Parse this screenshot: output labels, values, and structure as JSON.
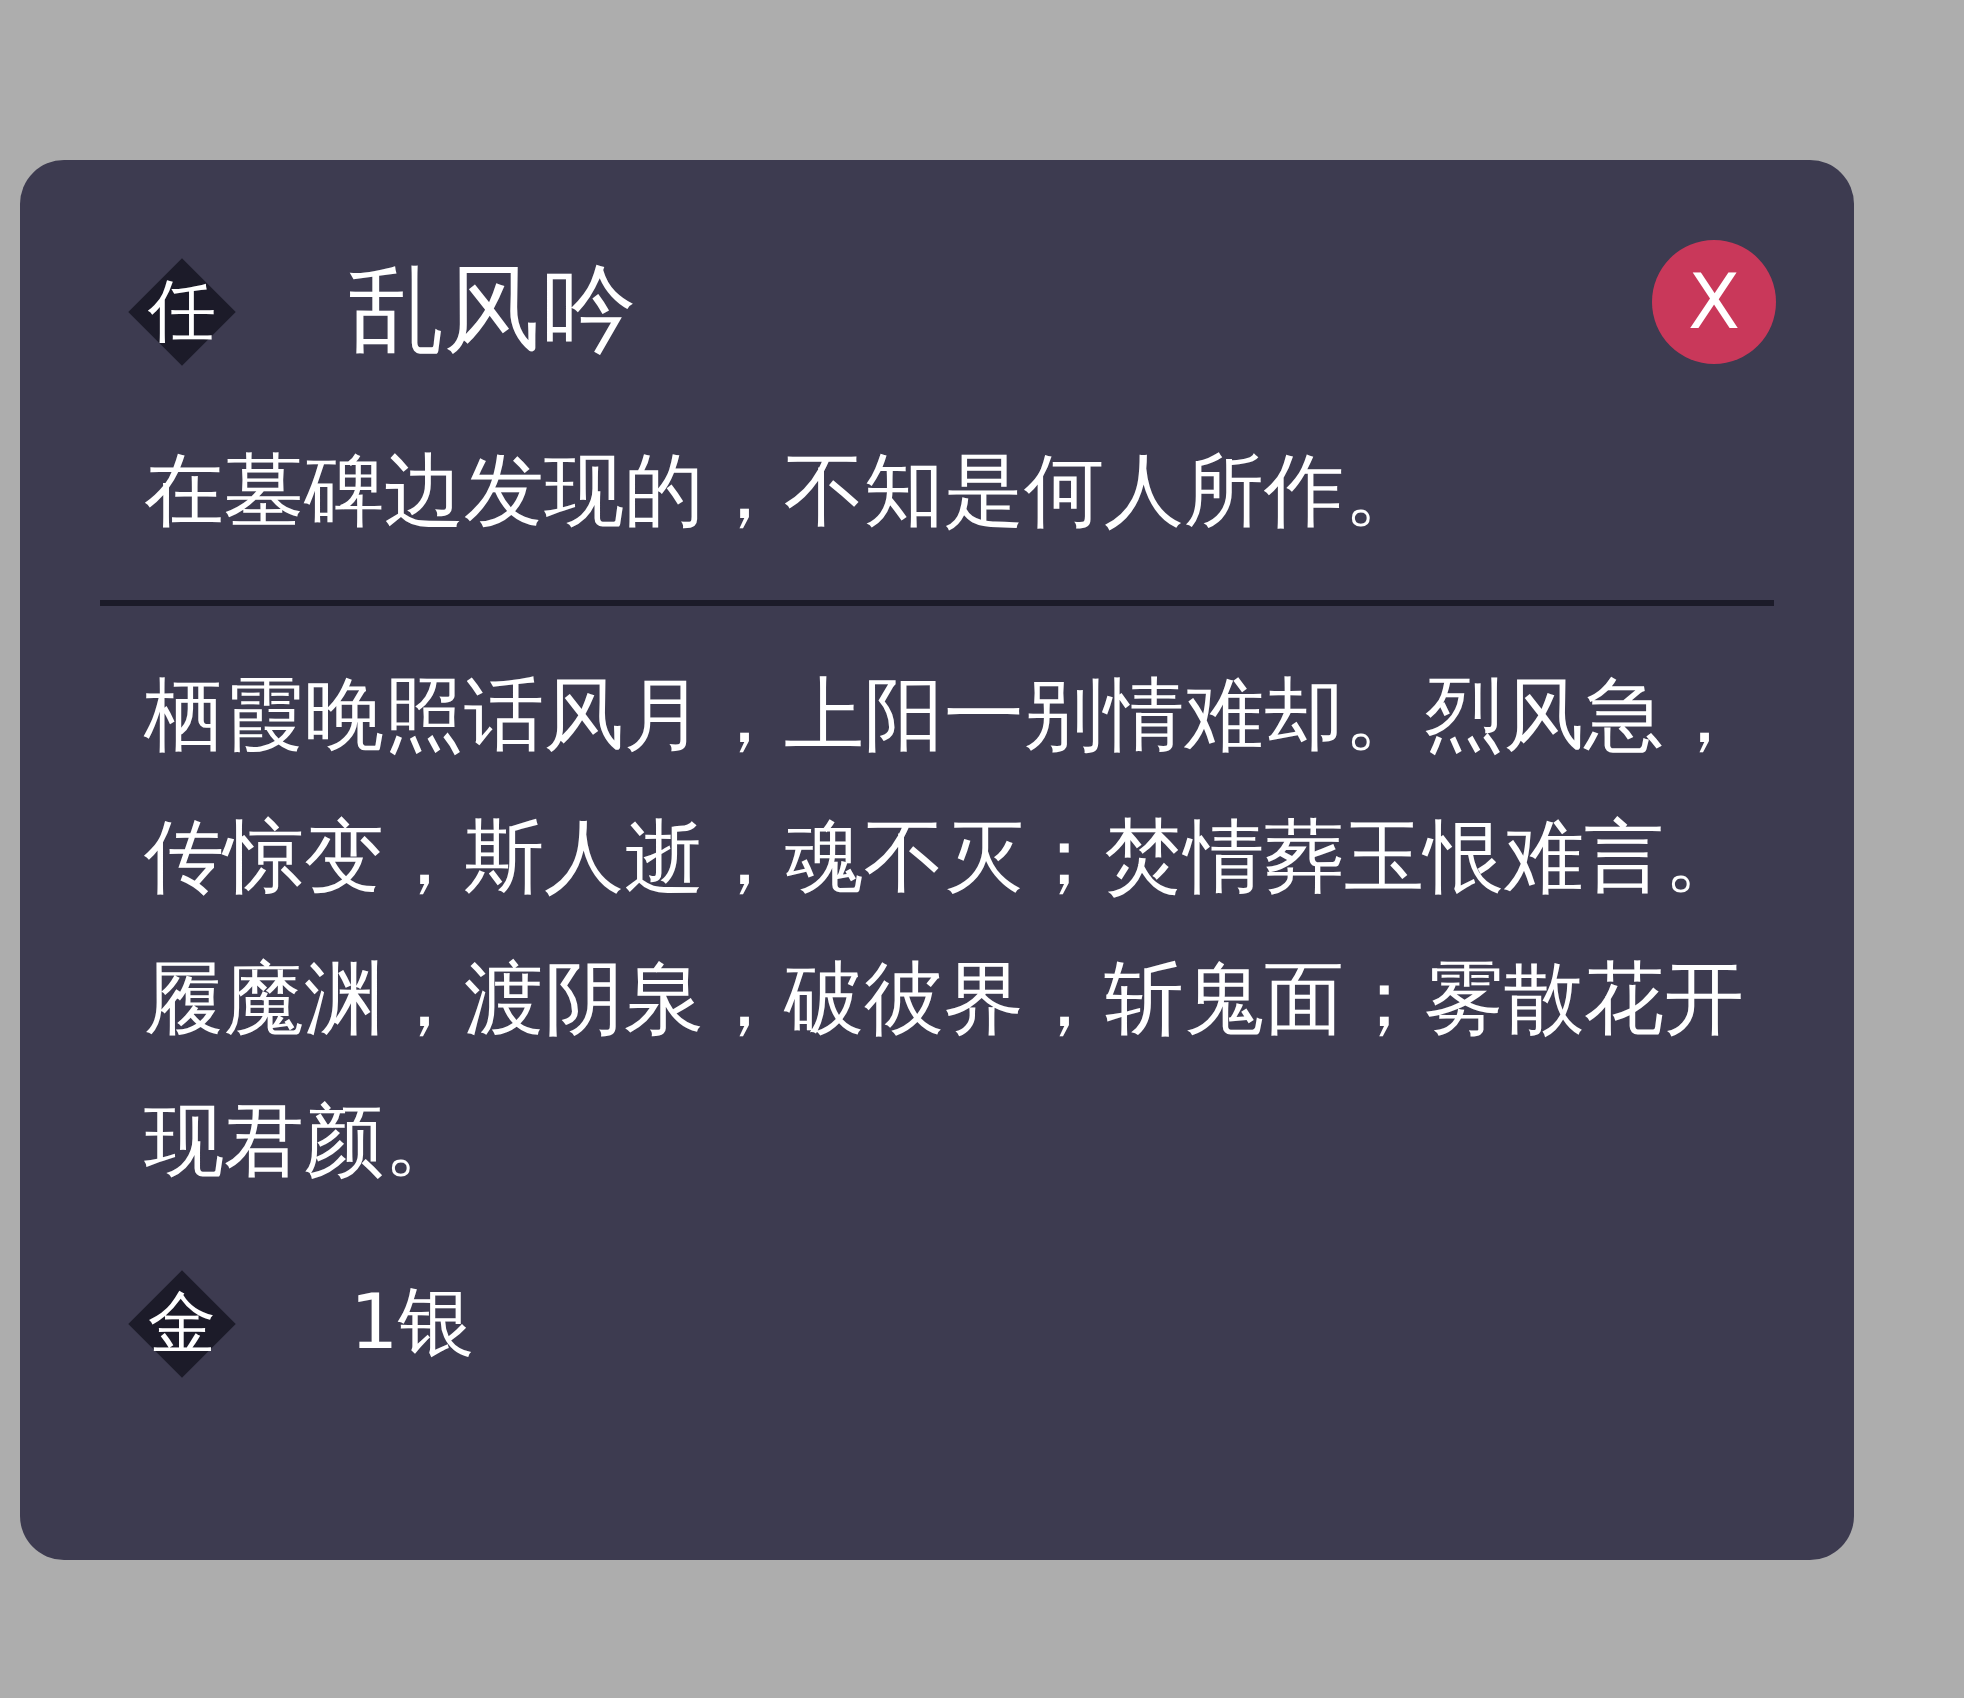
{
  "item": {
    "badge": "任",
    "name": "乱风吟",
    "close_label": "X"
  },
  "description": "在墓碑边发现的，不知是何人所作。",
  "poem": "栖霞晚照话风月，上阳一别情难却。烈风急，传惊变，斯人逝，魂不灭；焚情葬玉恨难言。履魔渊，渡阴泉，破彼界，斩鬼面；雾散花开现君颜。",
  "price": {
    "badge": "金",
    "value": "1银"
  }
}
